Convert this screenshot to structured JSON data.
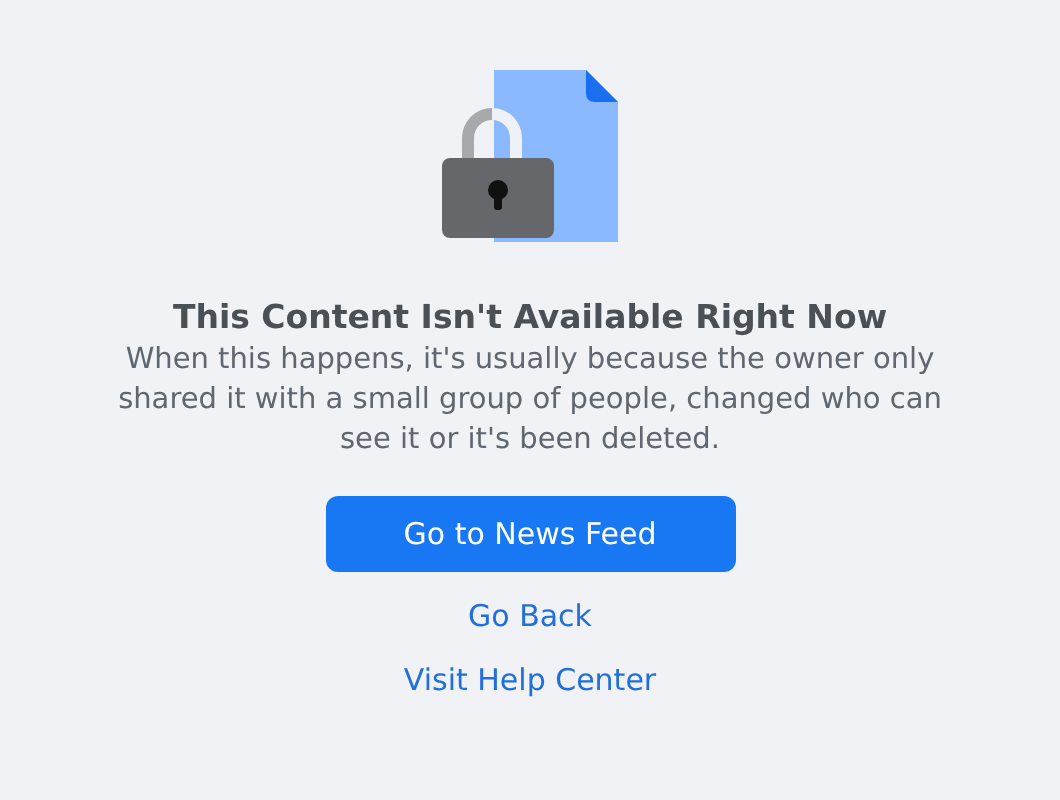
{
  "title": "This Content Isn't Available Right Now",
  "message": "When this happens, it's usually because the owner only shared it with a small group of people, changed who can see it or it's been deleted.",
  "primary_button": "Go to News Feed",
  "links": [
    "Go Back",
    "Visit Help Center"
  ]
}
